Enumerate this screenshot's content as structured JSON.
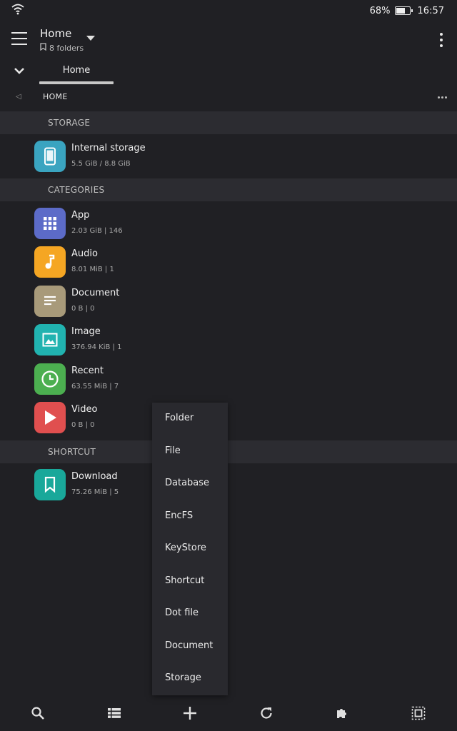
{
  "status": {
    "battery_percent": "68%",
    "battery_level": 0.68,
    "time": "16:57",
    "icons": [
      "wifi-icon",
      "battery-icon"
    ]
  },
  "toolbar": {
    "title": "Home",
    "subtitle": "8 folders",
    "icons": [
      "menu-icon",
      "bookmark-icon",
      "dropdown-icon",
      "more-vert-icon"
    ]
  },
  "tabs": {
    "active": "Home",
    "icons": [
      "chevron-down-icon"
    ]
  },
  "breadcrumb": {
    "label": "HOME",
    "icons": [
      "back-triangle-icon",
      "more-horiz-icon"
    ]
  },
  "sections": {
    "storage": "STORAGE",
    "categories": "CATEGORIES",
    "shortcut": "SHORTCUT"
  },
  "storage_items": [
    {
      "title": "Internal storage",
      "subtitle": "5.5 GiB / 8.8 GiB",
      "icon": "phone-icon",
      "color": "#3aa4c0"
    }
  ],
  "category_items": [
    {
      "title": "App",
      "subtitle": "2.03 GiB | 146",
      "icon": "apps-grid-icon",
      "color": "#5c6bc8"
    },
    {
      "title": "Audio",
      "subtitle": "8.01 MiB | 1",
      "icon": "music-note-icon",
      "color": "#f5a623"
    },
    {
      "title": "Document",
      "subtitle": "0 B | 0",
      "icon": "document-lines-icon",
      "color": "#a89a7a"
    },
    {
      "title": "Image",
      "subtitle": "376.94 KiB | 1",
      "icon": "image-icon",
      "color": "#21b3b0"
    },
    {
      "title": "Recent",
      "subtitle": "63.55 MiB | 7",
      "icon": "clock-icon",
      "color": "#4caf50"
    },
    {
      "title": "Video",
      "subtitle": "0 B | 0",
      "icon": "play-icon",
      "color": "#e04f4f"
    }
  ],
  "shortcut_items": [
    {
      "title": "Download",
      "subtitle": "75.26 MiB | 5",
      "icon": "bookmark-icon",
      "color": "#19a89a"
    }
  ],
  "popup_menu": {
    "items": [
      "Folder",
      "File",
      "Database",
      "EncFS",
      "KeyStore",
      "Shortcut",
      "Dot file",
      "Document",
      "Storage"
    ]
  },
  "bottom_bar": {
    "icons": [
      "search-icon",
      "list-view-icon",
      "add-icon",
      "refresh-icon",
      "extension-icon",
      "select-all-icon"
    ]
  }
}
